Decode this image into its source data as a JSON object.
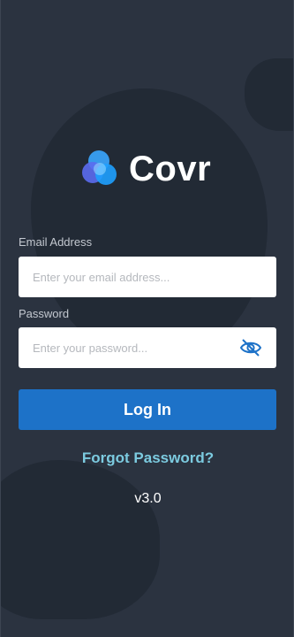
{
  "app": {
    "name": "Covr",
    "version": "v3.0"
  },
  "colors": {
    "background": "#2b3340",
    "blob": "#222a35",
    "primary_button": "#1d72c8",
    "link": "#7ccbe0"
  },
  "form": {
    "email": {
      "label": "Email Address",
      "placeholder": "Enter your email address...",
      "value": ""
    },
    "password": {
      "label": "Password",
      "placeholder": "Enter your password...",
      "value": "",
      "toggle_icon": "eye-slash-icon"
    },
    "login_label": "Log In",
    "forgot_label": "Forgot Password?"
  }
}
